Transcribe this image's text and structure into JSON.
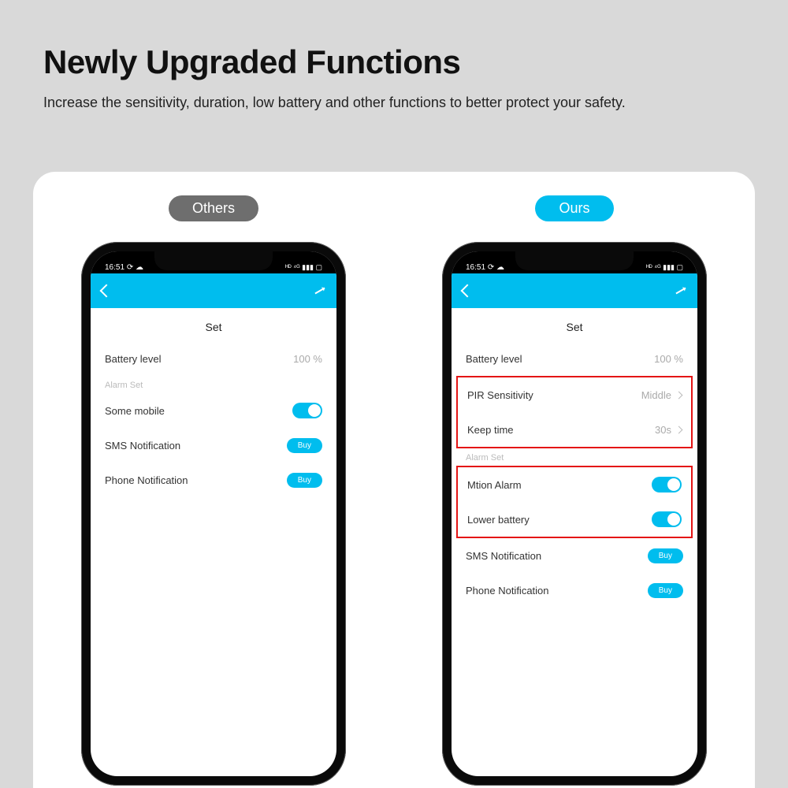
{
  "headline": {
    "title": "Newly Upgraded Functions",
    "subtitle": "Increase the sensitivity, duration, low battery and other functions to better protect your safety."
  },
  "badges": {
    "others": "Others",
    "ours": "Ours"
  },
  "status": {
    "time": "16:51",
    "indicators": "⟳ ☁",
    "right": "ᴴᴰ ⁴ᴳ ▮▮▮ ▢"
  },
  "app": {
    "title": "Set"
  },
  "others": {
    "battery_label": "Battery level",
    "battery_value": "100 %",
    "section": "Alarm Set",
    "some_mobile": "Some mobile",
    "sms": "SMS Notification",
    "phone": "Phone Notification",
    "buy": "Buy"
  },
  "ours": {
    "battery_label": "Battery level",
    "battery_value": "100 %",
    "pir_label": "PIR Sensitivity",
    "pir_value": "Middle",
    "keep_label": "Keep time",
    "keep_value": "30s",
    "section": "Alarm Set",
    "motion": "Mtion Alarm",
    "lowbat": "Lower battery",
    "sms": "SMS Notification",
    "phone": "Phone Notification",
    "buy": "Buy"
  }
}
